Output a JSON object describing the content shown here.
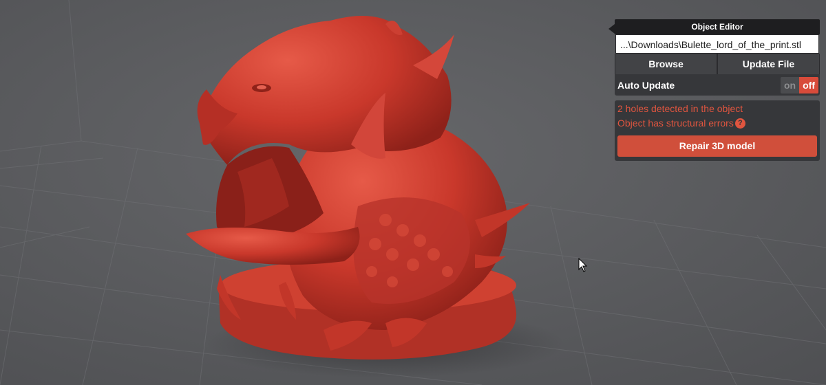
{
  "editor": {
    "title": "Object Editor",
    "file_path": "...\\Downloads\\Bulette_lord_of_the_print.stl",
    "browse_label": "Browse",
    "update_file_label": "Update File",
    "auto_update_label": "Auto Update",
    "toggle_on": "on",
    "toggle_off": "off",
    "auto_update_state": "off"
  },
  "errors": {
    "holes": "2 holes detected in the object",
    "structural": "Object has structural errors",
    "help_icon_glyph": "?"
  },
  "repair": {
    "label": "Repair 3D model"
  },
  "colors": {
    "model": "#c9382b",
    "accent": "#d84b3a",
    "viewport_bg": "#5a5b5e"
  },
  "icons": {
    "cursor": "arrow-cursor-icon",
    "help": "help-icon"
  }
}
